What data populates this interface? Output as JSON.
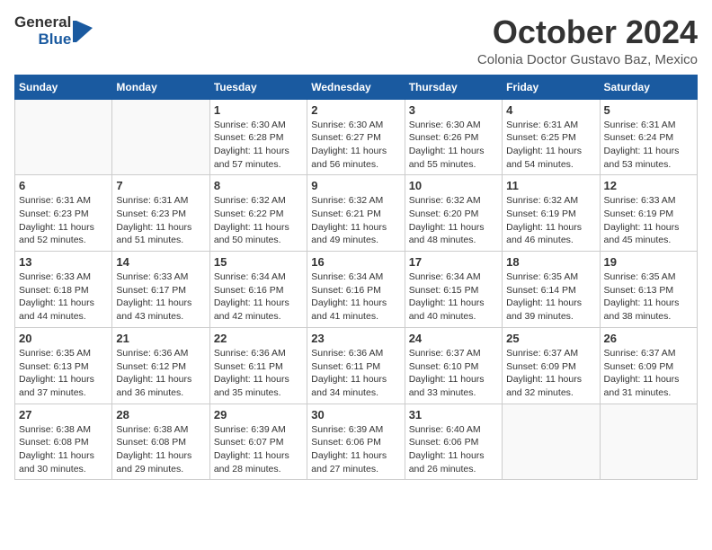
{
  "logo": {
    "line1": "General",
    "line2": "Blue"
  },
  "title": "October 2024",
  "location": "Colonia Doctor Gustavo Baz, Mexico",
  "weekdays": [
    "Sunday",
    "Monday",
    "Tuesday",
    "Wednesday",
    "Thursday",
    "Friday",
    "Saturday"
  ],
  "weeks": [
    [
      {
        "day": "",
        "info": ""
      },
      {
        "day": "",
        "info": ""
      },
      {
        "day": "1",
        "info": "Sunrise: 6:30 AM\nSunset: 6:28 PM\nDaylight: 11 hours and 57 minutes."
      },
      {
        "day": "2",
        "info": "Sunrise: 6:30 AM\nSunset: 6:27 PM\nDaylight: 11 hours and 56 minutes."
      },
      {
        "day": "3",
        "info": "Sunrise: 6:30 AM\nSunset: 6:26 PM\nDaylight: 11 hours and 55 minutes."
      },
      {
        "day": "4",
        "info": "Sunrise: 6:31 AM\nSunset: 6:25 PM\nDaylight: 11 hours and 54 minutes."
      },
      {
        "day": "5",
        "info": "Sunrise: 6:31 AM\nSunset: 6:24 PM\nDaylight: 11 hours and 53 minutes."
      }
    ],
    [
      {
        "day": "6",
        "info": "Sunrise: 6:31 AM\nSunset: 6:23 PM\nDaylight: 11 hours and 52 minutes."
      },
      {
        "day": "7",
        "info": "Sunrise: 6:31 AM\nSunset: 6:23 PM\nDaylight: 11 hours and 51 minutes."
      },
      {
        "day": "8",
        "info": "Sunrise: 6:32 AM\nSunset: 6:22 PM\nDaylight: 11 hours and 50 minutes."
      },
      {
        "day": "9",
        "info": "Sunrise: 6:32 AM\nSunset: 6:21 PM\nDaylight: 11 hours and 49 minutes."
      },
      {
        "day": "10",
        "info": "Sunrise: 6:32 AM\nSunset: 6:20 PM\nDaylight: 11 hours and 48 minutes."
      },
      {
        "day": "11",
        "info": "Sunrise: 6:32 AM\nSunset: 6:19 PM\nDaylight: 11 hours and 46 minutes."
      },
      {
        "day": "12",
        "info": "Sunrise: 6:33 AM\nSunset: 6:19 PM\nDaylight: 11 hours and 45 minutes."
      }
    ],
    [
      {
        "day": "13",
        "info": "Sunrise: 6:33 AM\nSunset: 6:18 PM\nDaylight: 11 hours and 44 minutes."
      },
      {
        "day": "14",
        "info": "Sunrise: 6:33 AM\nSunset: 6:17 PM\nDaylight: 11 hours and 43 minutes."
      },
      {
        "day": "15",
        "info": "Sunrise: 6:34 AM\nSunset: 6:16 PM\nDaylight: 11 hours and 42 minutes."
      },
      {
        "day": "16",
        "info": "Sunrise: 6:34 AM\nSunset: 6:16 PM\nDaylight: 11 hours and 41 minutes."
      },
      {
        "day": "17",
        "info": "Sunrise: 6:34 AM\nSunset: 6:15 PM\nDaylight: 11 hours and 40 minutes."
      },
      {
        "day": "18",
        "info": "Sunrise: 6:35 AM\nSunset: 6:14 PM\nDaylight: 11 hours and 39 minutes."
      },
      {
        "day": "19",
        "info": "Sunrise: 6:35 AM\nSunset: 6:13 PM\nDaylight: 11 hours and 38 minutes."
      }
    ],
    [
      {
        "day": "20",
        "info": "Sunrise: 6:35 AM\nSunset: 6:13 PM\nDaylight: 11 hours and 37 minutes."
      },
      {
        "day": "21",
        "info": "Sunrise: 6:36 AM\nSunset: 6:12 PM\nDaylight: 11 hours and 36 minutes."
      },
      {
        "day": "22",
        "info": "Sunrise: 6:36 AM\nSunset: 6:11 PM\nDaylight: 11 hours and 35 minutes."
      },
      {
        "day": "23",
        "info": "Sunrise: 6:36 AM\nSunset: 6:11 PM\nDaylight: 11 hours and 34 minutes."
      },
      {
        "day": "24",
        "info": "Sunrise: 6:37 AM\nSunset: 6:10 PM\nDaylight: 11 hours and 33 minutes."
      },
      {
        "day": "25",
        "info": "Sunrise: 6:37 AM\nSunset: 6:09 PM\nDaylight: 11 hours and 32 minutes."
      },
      {
        "day": "26",
        "info": "Sunrise: 6:37 AM\nSunset: 6:09 PM\nDaylight: 11 hours and 31 minutes."
      }
    ],
    [
      {
        "day": "27",
        "info": "Sunrise: 6:38 AM\nSunset: 6:08 PM\nDaylight: 11 hours and 30 minutes."
      },
      {
        "day": "28",
        "info": "Sunrise: 6:38 AM\nSunset: 6:08 PM\nDaylight: 11 hours and 29 minutes."
      },
      {
        "day": "29",
        "info": "Sunrise: 6:39 AM\nSunset: 6:07 PM\nDaylight: 11 hours and 28 minutes."
      },
      {
        "day": "30",
        "info": "Sunrise: 6:39 AM\nSunset: 6:06 PM\nDaylight: 11 hours and 27 minutes."
      },
      {
        "day": "31",
        "info": "Sunrise: 6:40 AM\nSunset: 6:06 PM\nDaylight: 11 hours and 26 minutes."
      },
      {
        "day": "",
        "info": ""
      },
      {
        "day": "",
        "info": ""
      }
    ]
  ]
}
